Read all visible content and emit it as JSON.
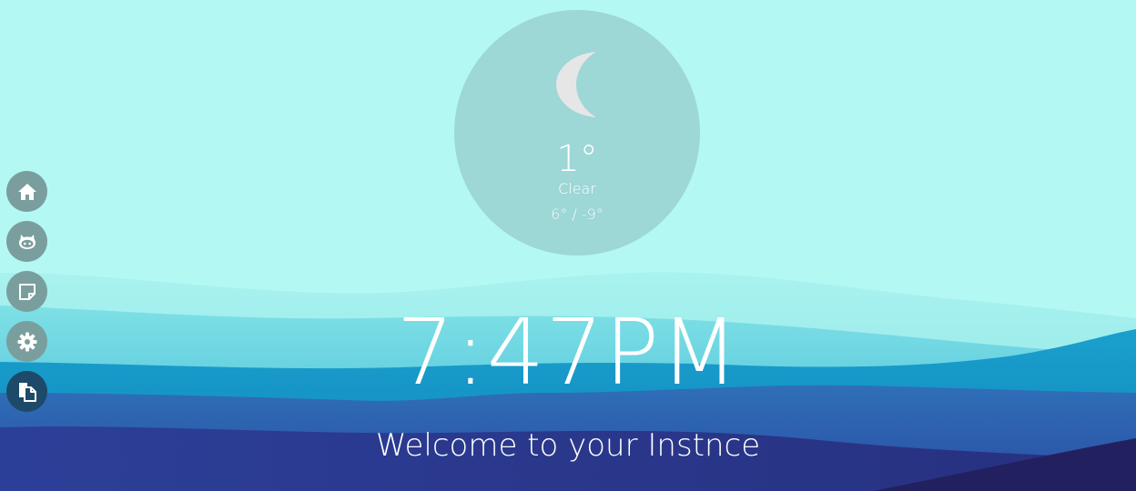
{
  "weather": {
    "icon": "moon-icon",
    "temperature": "1°",
    "condition": "Clear",
    "range": "6° / -9°"
  },
  "sidebar": {
    "items": [
      {
        "icon": "home-icon"
      },
      {
        "icon": "github-icon"
      },
      {
        "icon": "note-icon"
      },
      {
        "icon": "gear-icon"
      },
      {
        "icon": "documents-icon"
      }
    ]
  },
  "clock": {
    "time": "7:47PM"
  },
  "welcome": {
    "message": "Welcome to your Instnce"
  },
  "colors": {
    "sky": "#b4f8f4",
    "weather_circle": "#9dd7d6",
    "sidebar_button": "#7a9e9e",
    "sidebar_button_active": "#1e4a6a"
  }
}
